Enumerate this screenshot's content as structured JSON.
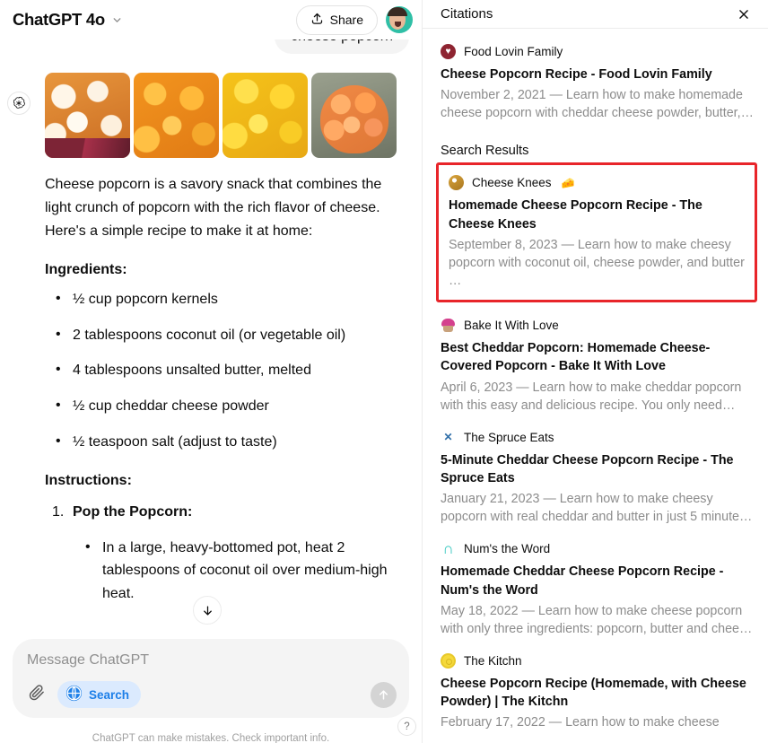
{
  "chat": {
    "model_name": "ChatGPT 4o",
    "share_label": "Share",
    "user_message": "cheese popcorn",
    "intro_paragraph": "Cheese popcorn is a savory snack that combines the light crunch of popcorn with the rich flavor of cheese. Here's a simple recipe to make it at home:",
    "ingredients_heading": "Ingredients:",
    "ingredients": [
      "½ cup popcorn kernels",
      "2 tablespoons coconut oil (or vegetable oil)",
      "4 tablespoons unsalted butter, melted",
      "½ cup cheddar cheese powder",
      "½ teaspoon salt (adjust to taste)"
    ],
    "instructions_heading": "Instructions:",
    "steps": [
      {
        "title": "Pop the Popcorn:",
        "bullets": [
          "In a large, heavy-bottomed pot, heat 2 tablespoons of coconut oil over medium-high heat."
        ]
      }
    ],
    "thumbnails": [
      "popcorn-white-cheddar-thumbnail",
      "popcorn-orange-cheddar-thumbnail",
      "popcorn-yellow-cheese-thumbnail",
      "popcorn-bowl-cheese-puffs-thumbnail"
    ]
  },
  "composer": {
    "placeholder": "Message ChatGPT",
    "search_label": "Search",
    "disclaimer": "ChatGPT can make mistakes. Check important info.",
    "help_label": "?"
  },
  "citations_panel": {
    "title": "Citations",
    "section_label": "Search Results",
    "highlight_color": "#e8252a",
    "citation": {
      "source": "Food Lovin Family",
      "favicon": "heart-in-circle-icon",
      "headline": "Cheese Popcorn Recipe - Food Lovin Family",
      "snippet": "November 2, 2021 — Learn how to make homemade cheese popcorn with cheddar cheese powder, butter,…"
    },
    "results": [
      {
        "source": "Cheese Knees",
        "source_emoji": "🧀",
        "favicon": "cheese-knees-icon",
        "headline": "Homemade Cheese Popcorn Recipe - The Cheese Knees",
        "snippet": "September 8, 2023 — Learn how to make cheesy popcorn with coconut oil, cheese powder, and butter …",
        "highlighted": true
      },
      {
        "source": "Bake It With Love",
        "source_emoji": "",
        "favicon": "cupcake-icon",
        "headline": "Best Cheddar Popcorn: Homemade Cheese-Covered Popcorn - Bake It With Love",
        "snippet": "April 6, 2023 — Learn how to make cheddar popcorn with this easy and delicious recipe. You only need…",
        "highlighted": false
      },
      {
        "source": "The Spruce Eats",
        "source_emoji": "",
        "favicon": "crossed-utensils-icon",
        "headline": "5-Minute Cheddar Cheese Popcorn Recipe - The Spruce Eats",
        "snippet": "January 21, 2023 — Learn how to make cheesy popcorn with real cheddar and butter in just 5 minute…",
        "highlighted": false
      },
      {
        "source": "Num's the Word",
        "source_emoji": "",
        "favicon": "num-arch-icon",
        "headline": "Homemade Cheddar Cheese Popcorn Recipe - Num's the Word",
        "snippet": "May 18, 2022 — Learn how to make cheese popcorn with only three ingredients: popcorn, butter and chee…",
        "highlighted": false
      },
      {
        "source": "The Kitchn",
        "source_emoji": "",
        "favicon": "kitchn-circle-icon",
        "headline": "Cheese Popcorn Recipe (Homemade, with Cheese Powder) | The Kitchn",
        "snippet": "February 17, 2022 — Learn how to make cheese",
        "highlighted": false
      }
    ]
  }
}
